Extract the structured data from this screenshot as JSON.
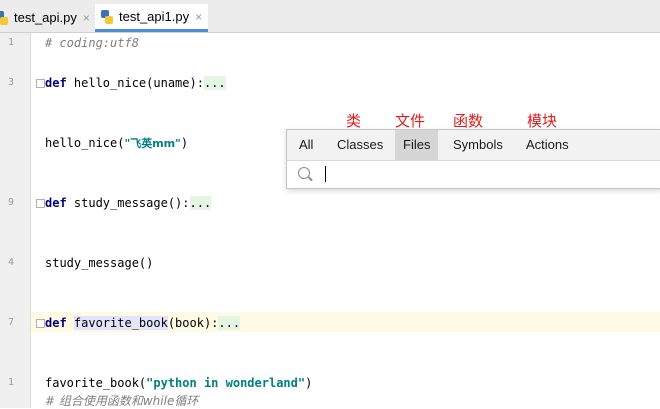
{
  "tabs": [
    {
      "label": "test_api.py",
      "close": "×"
    },
    {
      "label": "test_api1.py",
      "close": "×"
    }
  ],
  "line_numbers": [
    "1",
    "",
    "3",
    "",
    "",
    "",
    "",
    "",
    "9",
    "",
    "",
    "",
    "",
    "",
    "",
    "",
    "7",
    "",
    "",
    "",
    "1",
    ""
  ],
  "code": {
    "l1": "# coding:utf8",
    "l2_kw": "def ",
    "l2_name": "hello_nice(uname):",
    "l2_ell": "...",
    "l3_a": "hello_nice(",
    "l3_str": "\"飞英mm\"",
    "l3_b": ")",
    "l4_kw": "def ",
    "l4_name": "study_message():",
    "l4_ell": "...",
    "l5": "study_message()",
    "l6_kw": "def ",
    "l6_fn": "favorite_book",
    "l6_rest": "(book):",
    "l6_ell": "...",
    "l7_a": "favorite_book(",
    "l7_str": "\"python in wonderland\"",
    "l7_b": ")",
    "l8": "# 组合使用函数和while循环"
  },
  "gutter_numbers": {
    "n1": "1",
    "n3": "3",
    "n9": "9",
    "n4": "4",
    "n7": "7",
    "n1b": "1"
  },
  "popup": {
    "tabs": [
      "All",
      "Classes",
      "Files",
      "Symbols",
      "Actions"
    ],
    "selected": "Files",
    "search_value": ""
  },
  "annotations": [
    "类",
    "文件",
    "函数",
    "模块"
  ]
}
